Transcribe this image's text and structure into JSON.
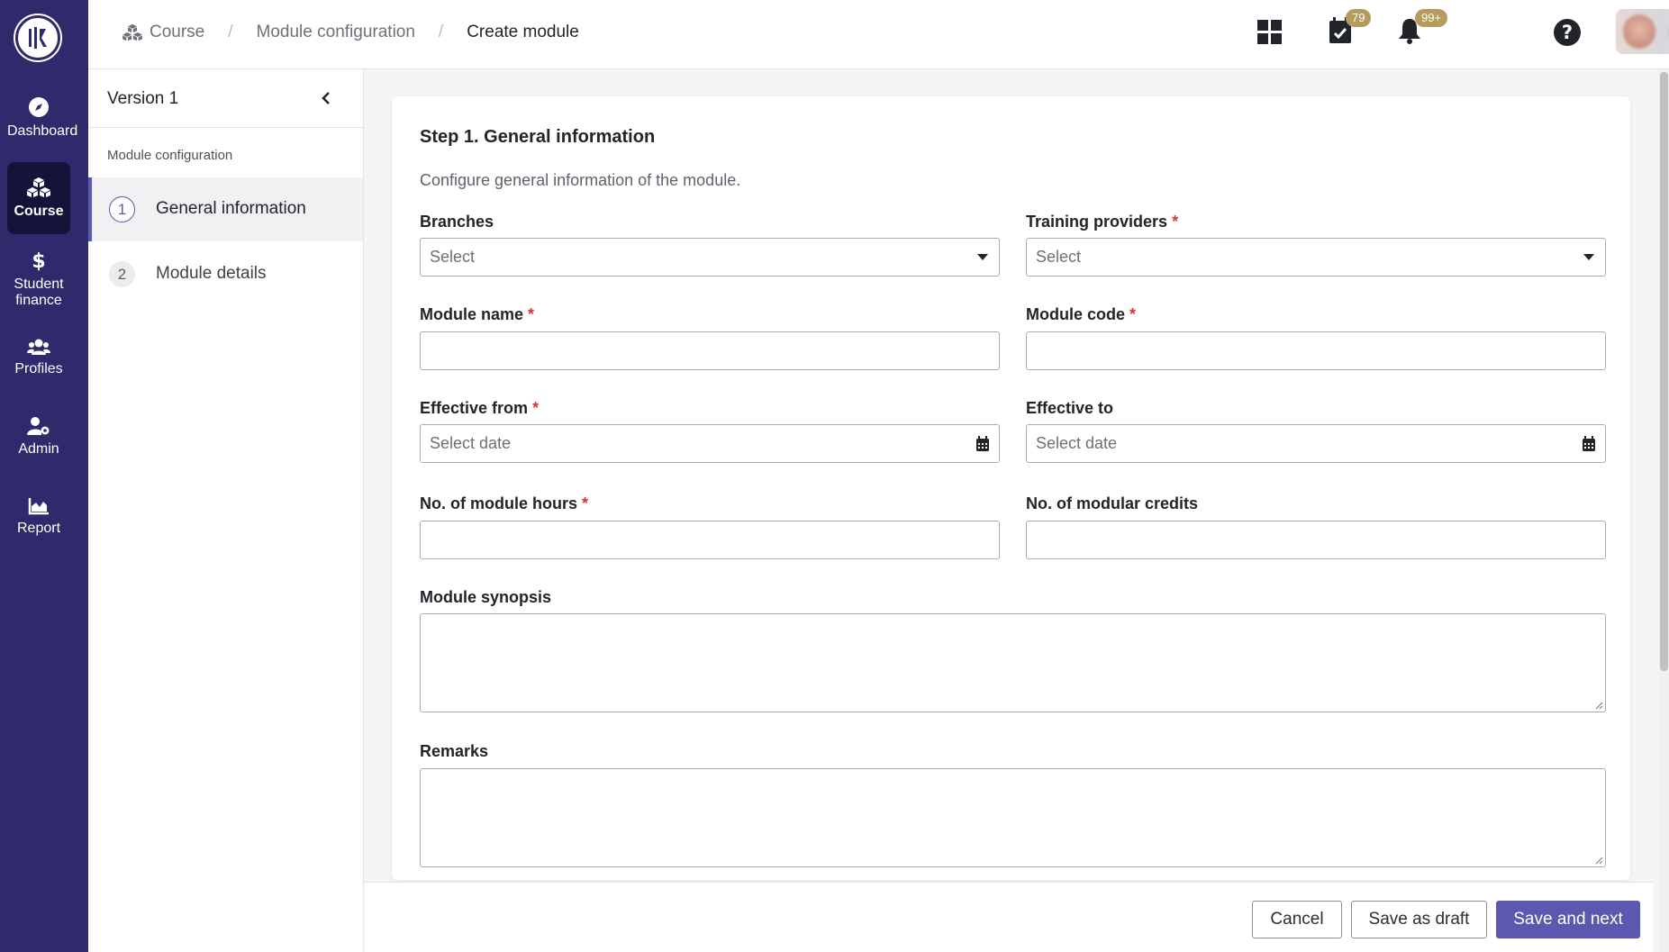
{
  "nav": {
    "items": [
      {
        "label": "Dashboard",
        "icon": "compass-icon"
      },
      {
        "label": "Course",
        "icon": "cubes-icon",
        "active": true
      },
      {
        "label": "Student finance",
        "icon": "dollar-icon"
      },
      {
        "label": "Profiles",
        "icon": "users-icon"
      },
      {
        "label": "Admin",
        "icon": "user-cog-icon"
      },
      {
        "label": "Report",
        "icon": "area-chart-icon"
      }
    ]
  },
  "breadcrumb": {
    "items": [
      "Course",
      "Module configuration",
      "Create module"
    ]
  },
  "header": {
    "tasks_badge": "79",
    "notifications_badge": "99+"
  },
  "sidepanel": {
    "version_title": "Version 1",
    "section_label": "Module configuration",
    "steps": [
      {
        "number": "1",
        "label": "General information",
        "active": true
      },
      {
        "number": "2",
        "label": "Module details",
        "active": false
      }
    ]
  },
  "form": {
    "title": "Step 1. General information",
    "description": "Configure general information of the module.",
    "branches": {
      "label": "Branches",
      "placeholder": "Select",
      "required": false
    },
    "training_providers": {
      "label": "Training providers",
      "placeholder": "Select",
      "required": true
    },
    "module_name": {
      "label": "Module name",
      "value": "",
      "required": true
    },
    "module_code": {
      "label": "Module code",
      "value": "",
      "required": true
    },
    "effective_from": {
      "label": "Effective from",
      "placeholder": "Select date",
      "required": true
    },
    "effective_to": {
      "label": "Effective to",
      "placeholder": "Select date",
      "required": false
    },
    "module_hours": {
      "label": "No. of module hours",
      "value": "",
      "required": true
    },
    "modular_credits": {
      "label": "No. of modular credits",
      "value": "",
      "required": false
    },
    "synopsis": {
      "label": "Module synopsis",
      "value": ""
    },
    "remarks": {
      "label": "Remarks",
      "value": ""
    },
    "required_marker": "*"
  },
  "footer": {
    "cancel": "Cancel",
    "save_draft": "Save as draft",
    "save_next": "Save and next"
  },
  "colors": {
    "nav_bg": "#2e2a6b",
    "nav_active": "#15133a",
    "primary": "#5c58b0",
    "badge": "#b59b5c",
    "required": "#d0353f"
  }
}
